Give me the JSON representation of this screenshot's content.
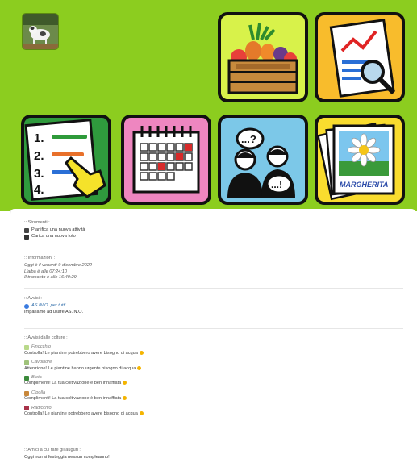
{
  "tools": {
    "title": ":: Strumenti :",
    "items": [
      {
        "label": "Pianifica una nuova attività",
        "icon": "trash-bin-icon"
      },
      {
        "label": "Carica una nuova foto",
        "icon": "photo-icon"
      }
    ]
  },
  "info": {
    "title": ":: Informazioni :",
    "lines": [
      "Oggi è il venerdì 9 dicembre 2022",
      "L'alba è alle 07:24:10",
      "Il tramonto è alle 16:40:29"
    ]
  },
  "notices": {
    "title": ":: Avvisi :",
    "author": "AS.IN.O. per tutti",
    "message": "Impariamo ad usare AS.IN.O."
  },
  "crop_alerts": {
    "title": ":: Avvisi dalle colture :",
    "items": [
      {
        "name": "Finocchio",
        "message": "Controlla! Le piantine potrebbero avere bisogno di acqua"
      },
      {
        "name": "Cavolfiore",
        "message": "Attenzione! Le piantine hanno urgente bisogno di acqua"
      },
      {
        "name": "Bieta",
        "message": "Complimenti! La tua coltivazione è ben innaffiata"
      },
      {
        "name": "Cipolla",
        "message": "Complimenti! La tua coltivazione è ben innaffiata"
      },
      {
        "name": "Radicchio",
        "message": "Controlla! Le piantine potrebbero avere bisogno di acqua"
      }
    ]
  },
  "birthdays": {
    "title": ":: Amici a cui fare gli auguri :",
    "message": "Oggi non si festeggia nessun compleanno!"
  },
  "tiles": {
    "photos_label": "MARGHERITA"
  },
  "colors": {
    "header_bg": "#8ccd1f",
    "emoji_yellow": "#f4b400"
  }
}
